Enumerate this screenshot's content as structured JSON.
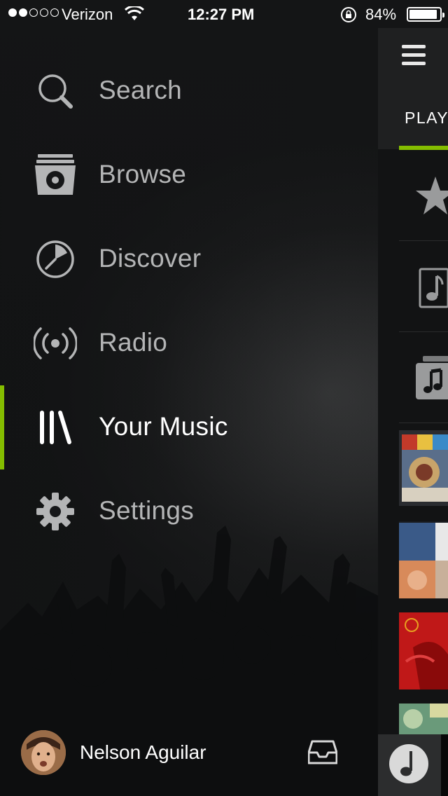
{
  "status_bar": {
    "carrier": "Verizon",
    "time": "12:27 PM",
    "battery_percent": "84%",
    "battery_level": 0.84,
    "signal_bars_filled": 2,
    "signal_bars_total": 5
  },
  "menu": {
    "items": [
      {
        "label": "Search",
        "icon": "search-icon",
        "active": false
      },
      {
        "label": "Browse",
        "icon": "browse-icon",
        "active": false
      },
      {
        "label": "Discover",
        "icon": "discover-icon",
        "active": false
      },
      {
        "label": "Radio",
        "icon": "radio-icon",
        "active": false
      },
      {
        "label": "Your Music",
        "icon": "your-music-icon",
        "active": true
      },
      {
        "label": "Settings",
        "icon": "gear-icon",
        "active": false
      }
    ]
  },
  "user": {
    "name": "Nelson Aguilar",
    "inbox_icon": "inbox-icon"
  },
  "right_panel": {
    "tab_label": "PLAY",
    "menu_icon": "hamburger-icon",
    "rows": [
      {
        "icon": "star-icon"
      },
      {
        "icon": "music-note-file-icon"
      },
      {
        "icon": "music-folder-icon"
      }
    ],
    "now_playing_icon": "music-note-icon"
  },
  "colors": {
    "accent": "#84bd00",
    "menu_text": "#b4b5b6",
    "active_text": "#ffffff",
    "background": "#141516"
  }
}
